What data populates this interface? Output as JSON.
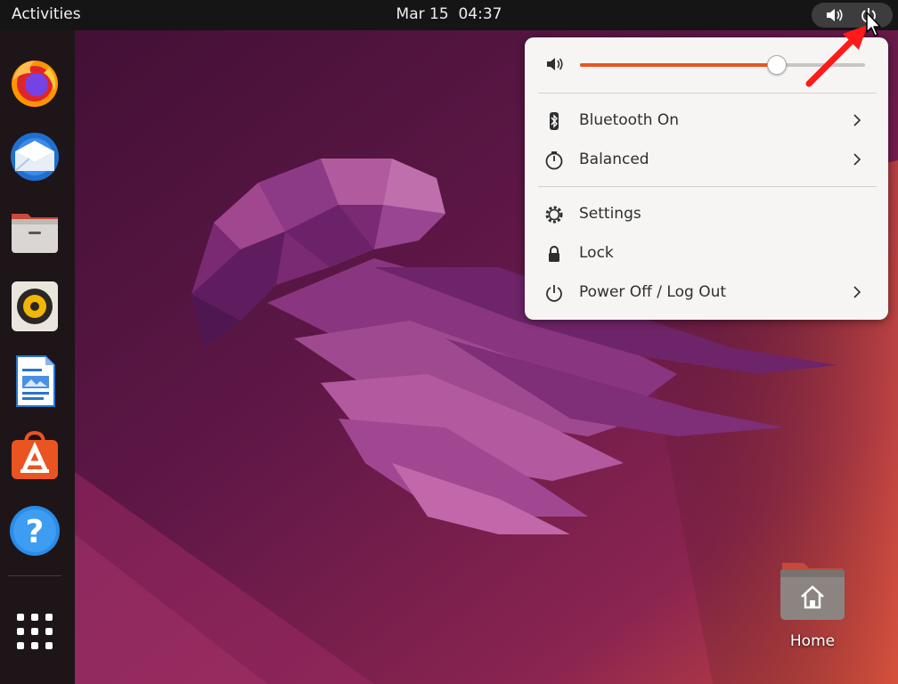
{
  "topbar": {
    "activities_label": "Activities",
    "date": "Mar 15",
    "time": "04:37",
    "tray_icons": [
      "volume-icon",
      "power-icon"
    ]
  },
  "dock": {
    "apps": [
      {
        "name": "Firefox",
        "icon": "firefox-icon"
      },
      {
        "name": "Thunderbird",
        "icon": "thunderbird-icon"
      },
      {
        "name": "Files",
        "icon": "files-icon"
      },
      {
        "name": "Rhythmbox",
        "icon": "rhythmbox-icon"
      },
      {
        "name": "LibreOffice Writer",
        "icon": "writer-icon"
      },
      {
        "name": "Ubuntu Software",
        "icon": "software-icon"
      },
      {
        "name": "Help",
        "icon": "help-icon"
      }
    ],
    "show_apps_icon": "app-grid-icon"
  },
  "desktop": {
    "home_label": "Home"
  },
  "quick_settings": {
    "volume": {
      "icon": "speaker-icon",
      "level": 0.69
    },
    "items": [
      {
        "label": "Bluetooth On",
        "icon": "bluetooth-icon",
        "has_arrow": true
      },
      {
        "label": "Balanced",
        "icon": "power-profile-icon",
        "has_arrow": true
      },
      {
        "label": "Settings",
        "icon": "gear-icon",
        "has_arrow": false
      },
      {
        "label": "Lock",
        "icon": "lock-icon",
        "has_arrow": false
      },
      {
        "label": "Power Off / Log Out",
        "icon": "power-icon",
        "has_arrow": true
      }
    ]
  },
  "colors": {
    "accent": "#e95420",
    "topbar": "#151515",
    "dock": "#1e1519",
    "menu_bg": "#f6f5f4",
    "annotation_arrow": "#ff1a1a"
  }
}
